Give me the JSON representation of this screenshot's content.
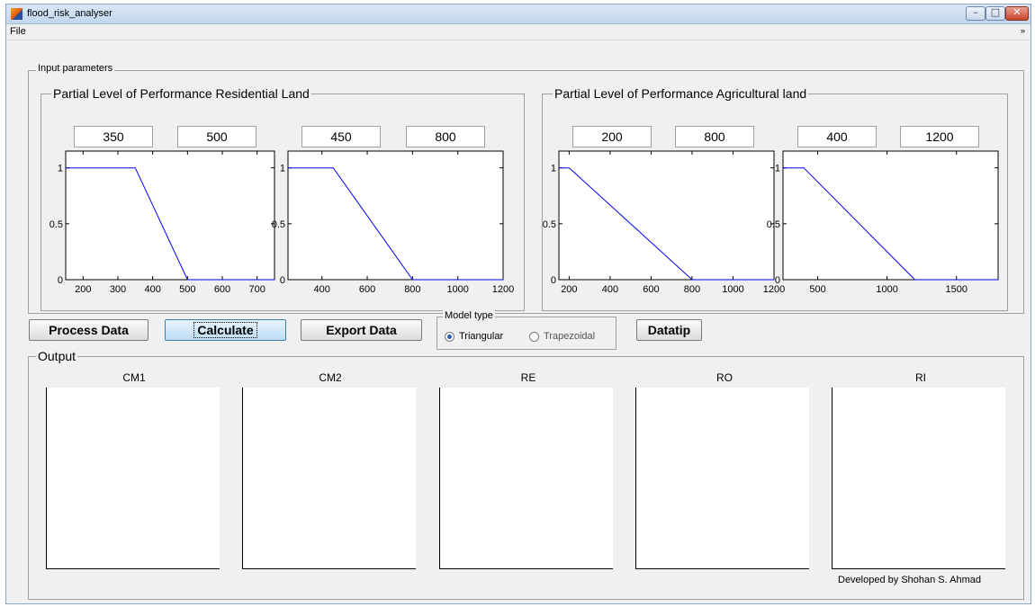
{
  "window": {
    "title": "flood_risk_analyser",
    "controls": {
      "minimize": "–",
      "maximize": "□",
      "close": "✕"
    }
  },
  "menu": {
    "file": "File",
    "overflow": "»"
  },
  "input_panel": {
    "title": "Input parameters",
    "residential": {
      "title": "Partial Level of Performance Residential Land",
      "values": [
        "350",
        "500",
        "450",
        "800"
      ]
    },
    "agricultural": {
      "title": "Partial Level of Performance Agricultural land",
      "values": [
        "200",
        "800",
        "400",
        "1200"
      ]
    }
  },
  "buttons": {
    "process": "Process Data",
    "calculate": "Calculate",
    "export": "Export Data",
    "datatip": "Datatip"
  },
  "model_type": {
    "title": "Model type",
    "options": [
      "Triangular",
      "Trapezoidal"
    ],
    "selected": "Triangular"
  },
  "output": {
    "title": "Output",
    "plots": [
      "CM1",
      "CM2",
      "RE",
      "RO",
      "RI"
    ],
    "credit": "Developed by Shohan S. Ahmad"
  },
  "chart_data": [
    {
      "type": "line",
      "series": [
        {
          "x": [
            150,
            350,
            500,
            750
          ],
          "y": [
            1,
            1,
            0,
            0
          ],
          "color": "#0000ff"
        }
      ],
      "xlim": [
        150,
        750
      ],
      "ylim": [
        0,
        1.15
      ],
      "xticks": [
        200,
        300,
        400,
        500,
        600,
        700
      ],
      "xticklabels": [
        "200",
        "300",
        "400",
        "500",
        "600",
        "700"
      ],
      "yticks": [
        0,
        0.5,
        1
      ],
      "yticklabels": [
        "0",
        "0.5",
        "1"
      ]
    },
    {
      "type": "line",
      "series": [
        {
          "x": [
            250,
            450,
            800,
            1200
          ],
          "y": [
            1,
            1,
            0,
            0
          ],
          "color": "#0000ff"
        }
      ],
      "xlim": [
        250,
        1200
      ],
      "ylim": [
        0,
        1.15
      ],
      "xticks": [
        400,
        600,
        800,
        1000,
        1200
      ],
      "xticklabels": [
        "400",
        "600",
        "800",
        "1000",
        "1200"
      ],
      "yticks": [
        0,
        0.5,
        1
      ],
      "yticklabels": [
        "0",
        "0.5",
        "1"
      ]
    },
    {
      "type": "line",
      "series": [
        {
          "x": [
            150,
            200,
            800,
            1200
          ],
          "y": [
            1,
            1,
            0,
            0
          ],
          "color": "#0000ff"
        }
      ],
      "xlim": [
        150,
        1200
      ],
      "ylim": [
        0,
        1.15
      ],
      "xticks": [
        200,
        400,
        600,
        800,
        1000,
        1200
      ],
      "xticklabels": [
        "200",
        "400",
        "600",
        "800",
        "1000",
        "1200"
      ],
      "yticks": [
        0,
        0.5,
        1
      ],
      "yticklabels": [
        "0",
        "0.5",
        "1"
      ]
    },
    {
      "type": "line",
      "series": [
        {
          "x": [
            250,
            400,
            1200,
            1800
          ],
          "y": [
            1,
            1,
            0,
            0
          ],
          "color": "#0000ff"
        }
      ],
      "xlim": [
        250,
        1800
      ],
      "ylim": [
        0,
        1.15
      ],
      "xticks": [
        500,
        1000,
        1500
      ],
      "xticklabels": [
        "500",
        "1000",
        "1500"
      ],
      "yticks": [
        0,
        0.5,
        1
      ],
      "yticklabels": [
        "0",
        "0.5",
        "1"
      ]
    }
  ]
}
